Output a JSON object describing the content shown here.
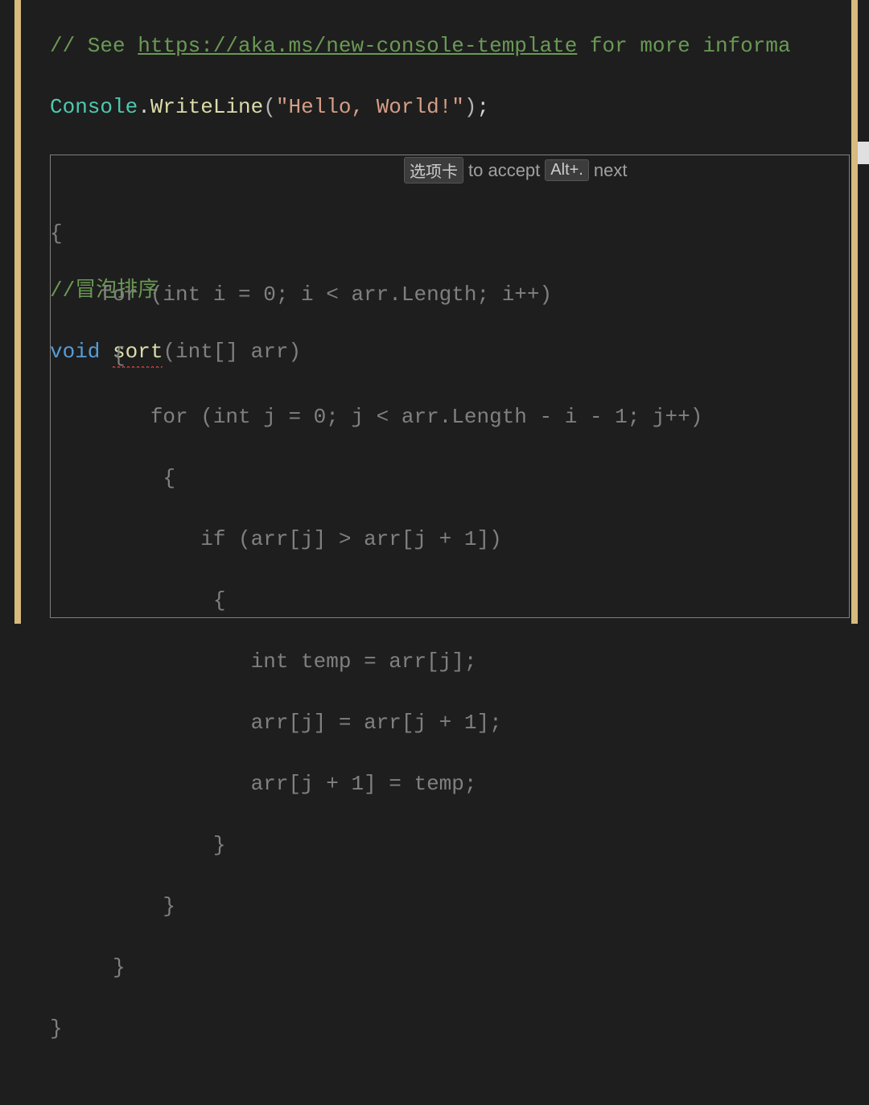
{
  "code": {
    "line1_comment_prefix": "// See ",
    "line1_link": "https://aka.ms/new-console-template",
    "line1_comment_suffix": " for more informa",
    "line2_class": "Console",
    "line2_dot": ".",
    "line2_method": "WriteLine",
    "line2_paren_open": "(",
    "line2_string": "\"Hello, World!\"",
    "line2_paren_close": ")",
    "line2_semi": ";",
    "line3_comment": "//冒泡排序",
    "line4_keyword": "void",
    "line4_space": " ",
    "line4_func": "sort",
    "line4_sig": "(int[] arr)"
  },
  "suggestion": {
    "l1": "{",
    "l2": "    for (int i = 0; i < arr.Length; i++)",
    "l3": "     {",
    "l4": "        for (int j = 0; j < arr.Length - i - 1; j++)",
    "l5": "         {",
    "l6": "            if (arr[j] > arr[j + 1])",
    "l7": "             {",
    "l8": "                int temp = arr[j];",
    "l9": "                arr[j] = arr[j + 1];",
    "l10": "                arr[j + 1] = temp;",
    "l11": "             }",
    "l12": "         }",
    "l13": "     }",
    "l14": "}"
  },
  "hint": {
    "key1": "选项卡",
    "text1": "to accept",
    "key2": "Alt+.",
    "text2": "next"
  }
}
